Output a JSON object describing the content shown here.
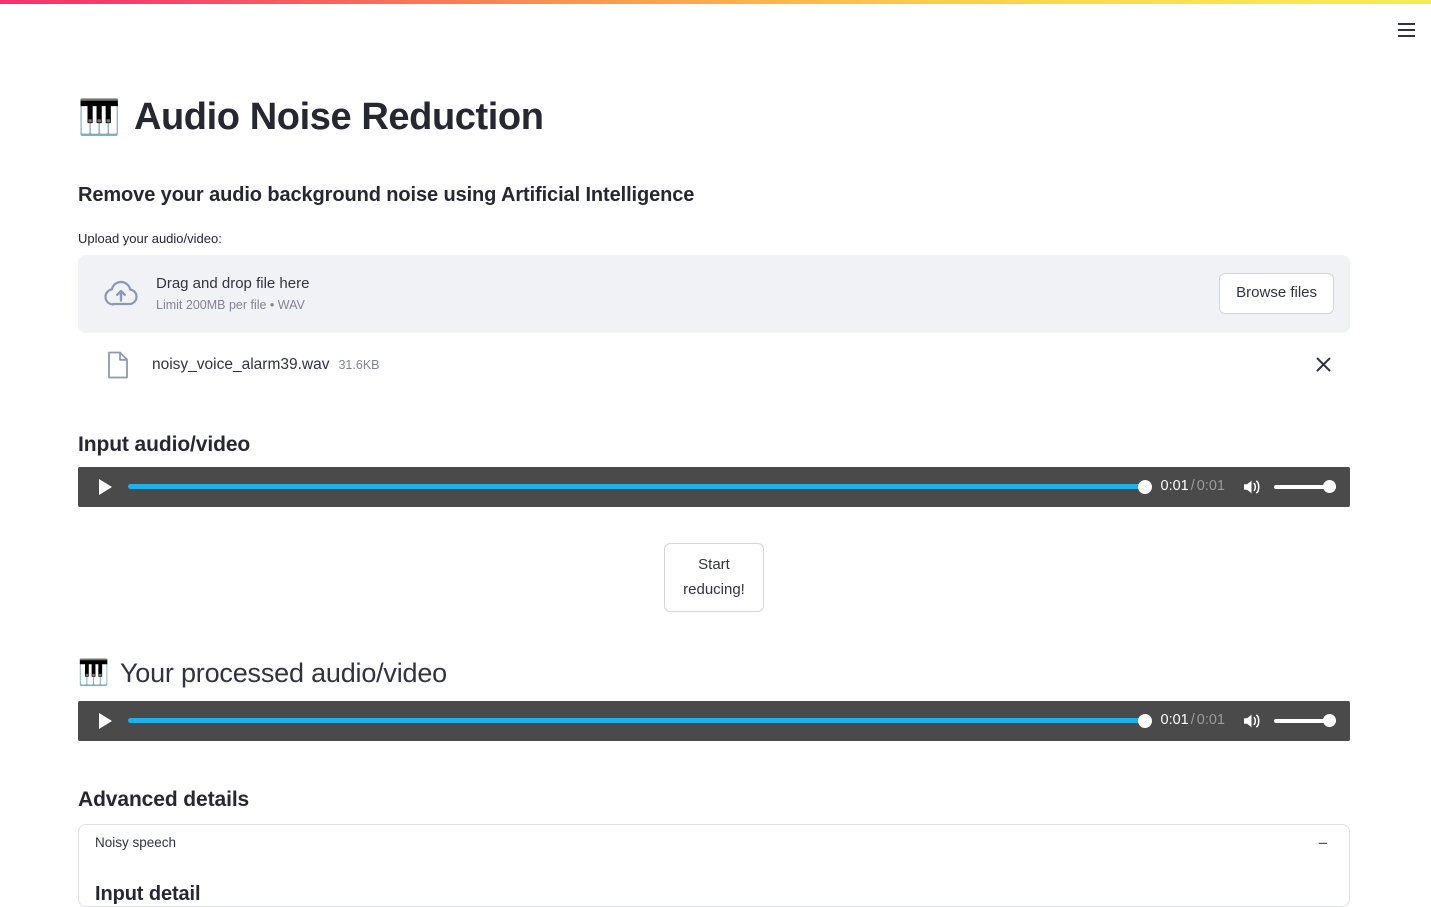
{
  "window": {
    "menu_icon": "hamburger-menu-icon",
    "decoration_gradient_from": "#f5316b",
    "decoration_gradient_to": "#f7ec54"
  },
  "header": {
    "icon": "musical-notes-icon",
    "title": "Audio Noise Reduction",
    "subtitle": "Remove your audio background noise using Artificial Intelligence"
  },
  "uploader": {
    "label": "Upload your audio/video:",
    "icon": "cloud-upload-icon",
    "drop_text": "Drag and drop file here",
    "limit_text": "Limit 200MB per file • WAV",
    "browse_label": "Browse files"
  },
  "uploaded_file": {
    "icon": "file-icon",
    "name": "noisy_voice_alarm39.wav",
    "size": "31.6KB",
    "remove_icon": "close-icon"
  },
  "input_section": {
    "heading": "Input audio/video",
    "player": {
      "play_icon": "play-icon",
      "current_time": "0:01",
      "separator": "/",
      "total_time": "0:01",
      "volume_icon": "volume-high-icon",
      "progress_percent": 100,
      "volume_percent": 100,
      "track_color": "#1fb2ea",
      "background_color": "#4a4a4a"
    }
  },
  "action": {
    "start_label_line1": "Start",
    "start_label_line2": "reducing!"
  },
  "output_section": {
    "icon": "musical-notes-icon",
    "heading": "Your processed audio/video",
    "player": {
      "play_icon": "play-icon",
      "current_time": "0:01",
      "separator": "/",
      "total_time": "0:01",
      "volume_icon": "volume-high-icon",
      "progress_percent": 100,
      "volume_percent": 100
    }
  },
  "advanced": {
    "heading": "Advanced details",
    "expander_title": "Noisy speech",
    "expander_toggle_icon": "minus-icon",
    "expander_toggle_glyph": "−",
    "body_heading": "Input detail"
  }
}
